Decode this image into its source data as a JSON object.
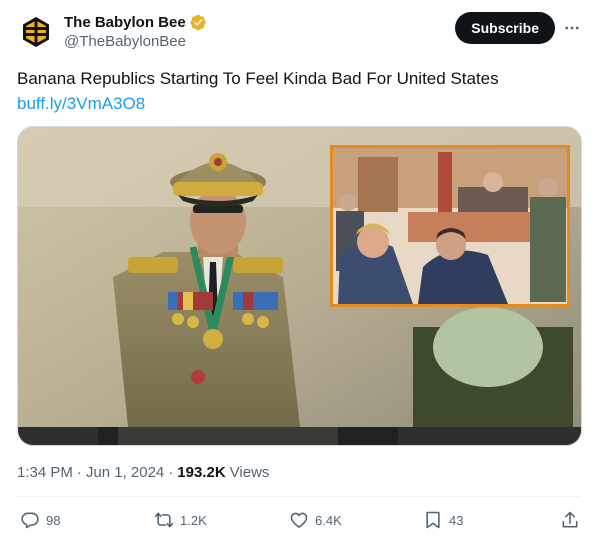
{
  "author": {
    "display_name": "The Babylon Bee",
    "handle": "@TheBabylonBee",
    "verified_color": "#e8b229"
  },
  "header": {
    "subscribe_label": "Subscribe",
    "more_icon": "more-horizontal-icon"
  },
  "post": {
    "text": "Banana Republics Starting To Feel Kinda Bad For United States",
    "link": "buff.ly/3VmA3O8"
  },
  "meta": {
    "time": "1:34 PM",
    "separator": "·",
    "date": "Jun 1, 2024",
    "views_count": "193.2K",
    "views_label": "Views"
  },
  "actions": {
    "replies": "98",
    "reposts": "1.2K",
    "likes": "6.4K",
    "bookmarks": "43"
  },
  "colors": {
    "accent": "#1d9bf0",
    "text": "#0f1419",
    "secondary": "#536471",
    "button": "#0f1419"
  }
}
